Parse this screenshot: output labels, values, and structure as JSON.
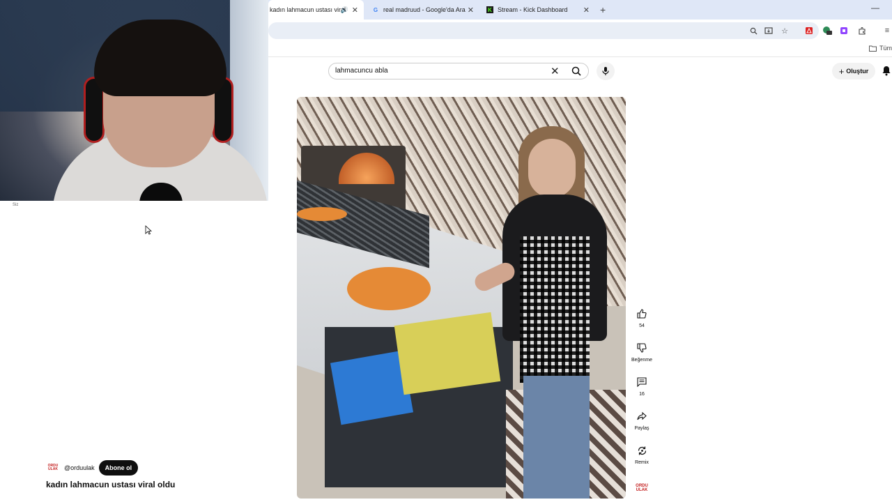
{
  "browser": {
    "tabs": [
      {
        "title": "kadın lahmacun ustası viral",
        "active": true
      },
      {
        "title": "real madruud - Google'da Ara",
        "active": false
      },
      {
        "title": "Stream - Kick Dashboard",
        "active": false
      }
    ],
    "bookmark_folder": "Tüm"
  },
  "header": {
    "search_value": "lahmacuncu abla",
    "create_label": "Oluştur"
  },
  "webcam": {
    "caption": "Siz"
  },
  "video": {
    "channel_handle": "@orduulak",
    "channel_logo_text_top": "ORDU",
    "channel_logo_text_bottom": "ULAK",
    "subscribe_label": "Abone ol",
    "title": "kadın lahmacun ustası viral oldu"
  },
  "actions": {
    "like_count": "54",
    "dislike_label": "Beğenme",
    "comment_count": "16",
    "share_label": "Paylaş",
    "remix_label": "Remix"
  },
  "colors": {
    "tabstrip": "#dfe7f7",
    "subscribe_bg": "#0f0f0f",
    "headset_accent": "#b01f1f",
    "brand_red": "#c31d1d"
  }
}
